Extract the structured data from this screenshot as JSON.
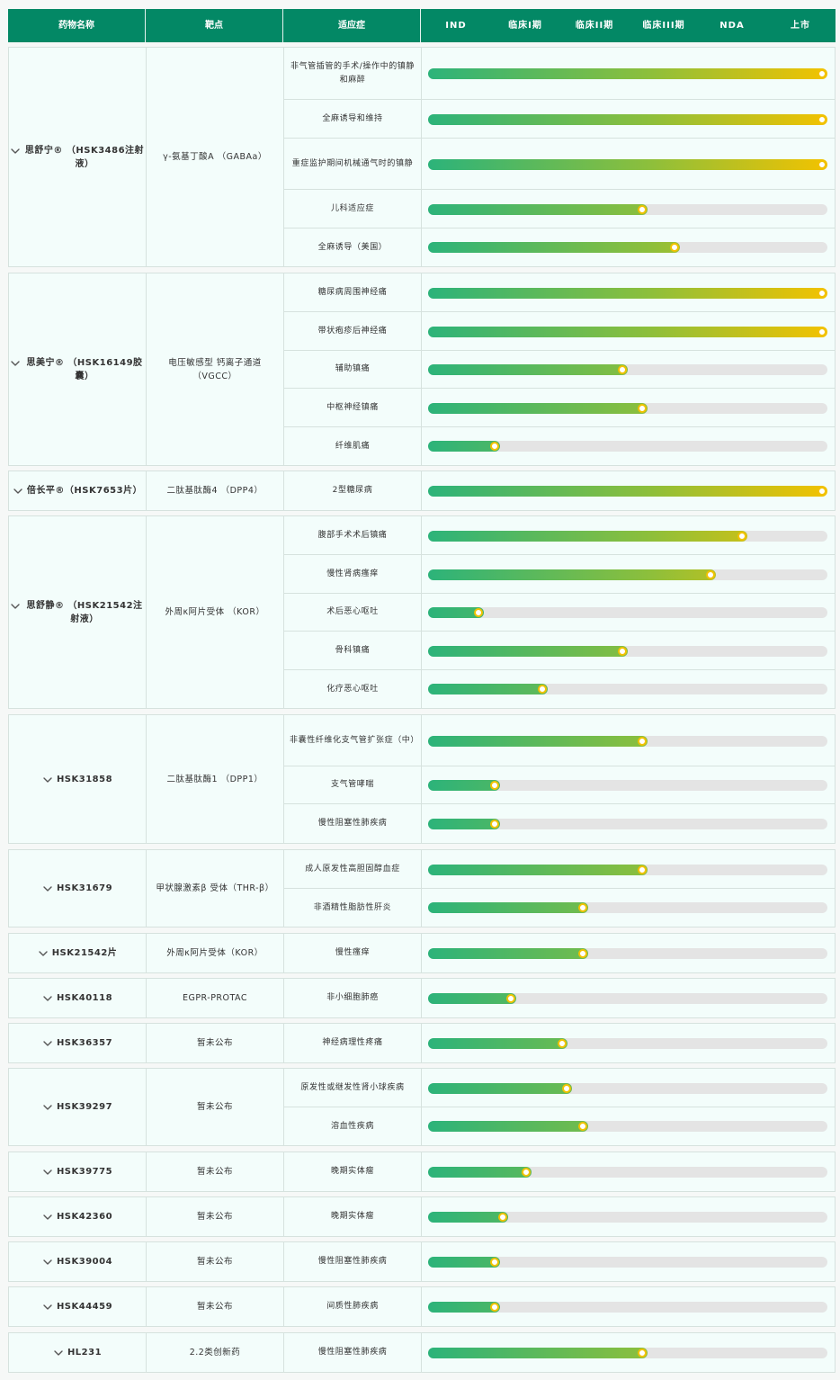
{
  "header": {
    "drug": "药物名称",
    "target": "靶点",
    "indication": "适应症",
    "stages": [
      "IND",
      "临床I期",
      "临床II期",
      "临床III期",
      "NDA",
      "上市"
    ]
  },
  "colors": {
    "header_bg": "#038865",
    "bar_start": "#2cb37a",
    "bar_end": "#f2c200",
    "track": "#e4e4e4",
    "row_bg": "#f3fdfb"
  },
  "icons": {
    "expand": "chevron-down-icon"
  },
  "groups": [
    {
      "drug": "思舒宁® （HSK3486注射液）",
      "target": "γ-氨基丁酸A （GABAa）",
      "indications": [
        {
          "name": "非气管插管的手术/操作中的镇静和麻醉",
          "progress": 1.0
        },
        {
          "name": "全麻诱导和维持",
          "progress": 1.0
        },
        {
          "name": "重症监护期间机械通气时的镇静",
          "progress": 1.0
        },
        {
          "name": "儿科适应症",
          "progress": 0.55
        },
        {
          "name": "全麻诱导（美国）",
          "progress": 0.63
        }
      ]
    },
    {
      "drug": "思美宁® （HSK16149胶囊）",
      "target": "电压敏感型 钙离子通道（VGCC）",
      "indications": [
        {
          "name": "糖尿病周围神经痛",
          "progress": 1.0
        },
        {
          "name": "带状疱疹后神经痛",
          "progress": 1.0
        },
        {
          "name": "辅助镇痛",
          "progress": 0.5
        },
        {
          "name": "中枢神经镇痛",
          "progress": 0.55
        },
        {
          "name": "纤维肌痛",
          "progress": 0.18
        }
      ]
    },
    {
      "drug": "倍长平®（HSK7653片）",
      "target": "二肽基肽酶4 （DPP4）",
      "indications": [
        {
          "name": "2型糖尿病",
          "progress": 1.0
        }
      ]
    },
    {
      "drug": "思舒静® （HSK21542注射液）",
      "target": "外周κ阿片受体 （KOR）",
      "indications": [
        {
          "name": "腹部手术术后镇痛",
          "progress": 0.8
        },
        {
          "name": "慢性肾病瘙痒",
          "progress": 0.72
        },
        {
          "name": "术后恶心呕吐",
          "progress": 0.14
        },
        {
          "name": "骨科镇痛",
          "progress": 0.5
        },
        {
          "name": "化疗恶心呕吐",
          "progress": 0.3
        }
      ]
    },
    {
      "drug": "HSK31858",
      "target": "二肽基肽酶1 （DPP1）",
      "indications": [
        {
          "name": "非囊性纤维化支气管扩张症（中）",
          "progress": 0.55
        },
        {
          "name": "支气管哮喘",
          "progress": 0.18
        },
        {
          "name": "慢性阻塞性肺疾病",
          "progress": 0.18
        }
      ]
    },
    {
      "drug": "HSK31679",
      "target": "甲状腺激素β 受体（THR-β）",
      "indications": [
        {
          "name": "成人原发性高胆固醇血症",
          "progress": 0.55
        },
        {
          "name": "非酒精性脂肪性肝炎",
          "progress": 0.4
        }
      ]
    },
    {
      "drug": "HSK21542片",
      "target": "外周κ阿片受体（KOR）",
      "indications": [
        {
          "name": "慢性瘙痒",
          "progress": 0.4
        }
      ]
    },
    {
      "drug": "HSK40118",
      "target": "EGPR-PROTAC",
      "indications": [
        {
          "name": "非小细胞肺癌",
          "progress": 0.22
        }
      ]
    },
    {
      "drug": "HSK36357",
      "target": "暂未公布",
      "indications": [
        {
          "name": "神经病理性疼痛",
          "progress": 0.35
        }
      ]
    },
    {
      "drug": "HSK39297",
      "target": "暂未公布",
      "indications": [
        {
          "name": "原发性或继发性肾小球疾病",
          "progress": 0.36
        },
        {
          "name": "溶血性疾病",
          "progress": 0.4
        }
      ]
    },
    {
      "drug": "HSK39775",
      "target": "暂未公布",
      "indications": [
        {
          "name": "晚期实体瘤",
          "progress": 0.26
        }
      ]
    },
    {
      "drug": "HSK42360",
      "target": "暂未公布",
      "indications": [
        {
          "name": "晚期实体瘤",
          "progress": 0.2
        }
      ]
    },
    {
      "drug": "HSK39004",
      "target": "暂未公布",
      "indications": [
        {
          "name": "慢性阻塞性肺疾病",
          "progress": 0.18
        }
      ]
    },
    {
      "drug": "HSK44459",
      "target": "暂未公布",
      "indications": [
        {
          "name": "间质性肺疾病",
          "progress": 0.18
        }
      ]
    },
    {
      "drug": "HL231",
      "target": "2.2类创新药",
      "indications": [
        {
          "name": "慢性阻塞性肺疾病",
          "progress": 0.55
        }
      ]
    }
  ]
}
